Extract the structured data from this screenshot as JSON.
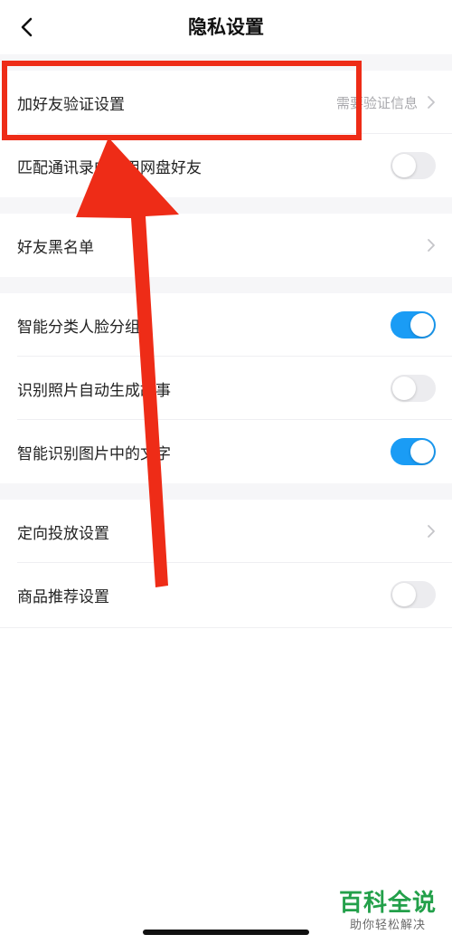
{
  "nav": {
    "title": "隐私设置"
  },
  "rows": [
    {
      "label": "加好友验证设置",
      "value": "需要验证信息"
    },
    {
      "label": "匹配通讯录中使用网盘好友",
      "toggle": "off"
    },
    {
      "label": "好友黑名单"
    },
    {
      "label": "智能分类人脸分组",
      "toggle": "on"
    },
    {
      "label": "识别照片自动生成故事",
      "toggle": "off"
    },
    {
      "label": "智能识别图片中的文字",
      "toggle": "on"
    },
    {
      "label": "定向投放设置"
    },
    {
      "label": "商品推荐设置",
      "toggle": "off"
    }
  ],
  "watermark": {
    "title": "百科全说",
    "subtitle": "助你轻松解决"
  },
  "colors": {
    "toggle_on": "#1a9cf5",
    "toggle_off": "#ececef",
    "annotation_red": "#ee2c17",
    "watermark_green": "#23a04a"
  }
}
